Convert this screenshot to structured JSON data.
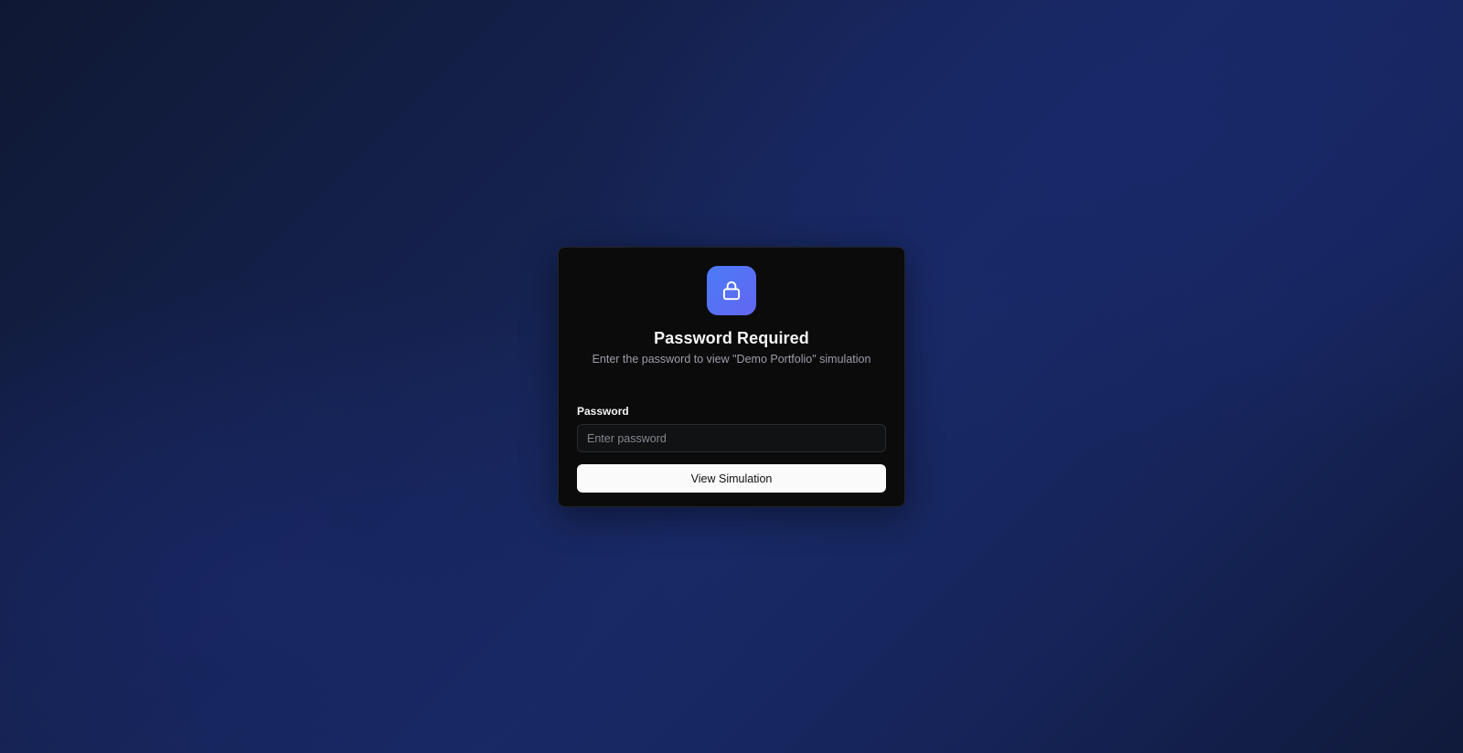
{
  "dialog": {
    "icon": "lock-icon",
    "title": "Password Required",
    "subtitle": "Enter the password to view \"Demo Portfolio\" simulation",
    "password_label": "Password",
    "password_placeholder": "Enter password",
    "password_value": "",
    "submit_label": "View Simulation"
  },
  "colors": {
    "accent_gradient_start": "#4a7bf7",
    "accent_gradient_end": "#6366f1",
    "card_background": "#0b0b0c",
    "page_background": "#15224f"
  }
}
